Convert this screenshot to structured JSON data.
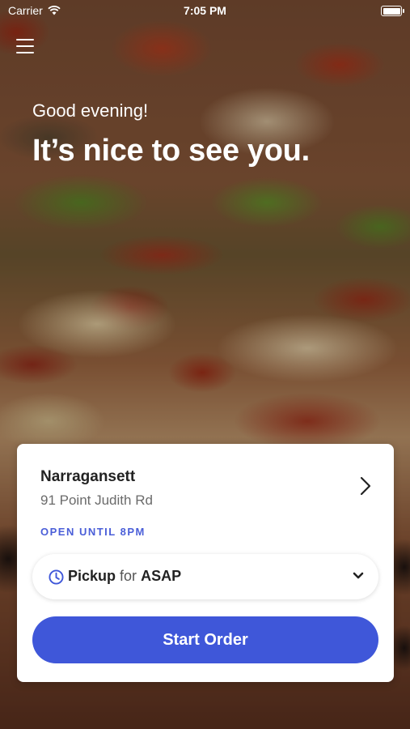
{
  "status_bar": {
    "carrier": "Carrier",
    "time": "7:05 PM"
  },
  "greeting": {
    "subtitle": "Good evening!",
    "title": "It’s nice to see you."
  },
  "location": {
    "name": "Narragansett",
    "address": "91 Point Judith Rd",
    "status": "OPEN UNTIL 8PM"
  },
  "order_mode": {
    "type": "Pickup",
    "connector": "for",
    "time": "ASAP"
  },
  "start_button": {
    "label": "Start Order"
  },
  "colors": {
    "accent": "#3f57d9",
    "status_text": "#4a5ed8"
  },
  "icons": [
    "wifi-icon",
    "battery-icon",
    "menu-icon",
    "chevron-right-icon",
    "clock-icon",
    "chevron-down-icon"
  ]
}
